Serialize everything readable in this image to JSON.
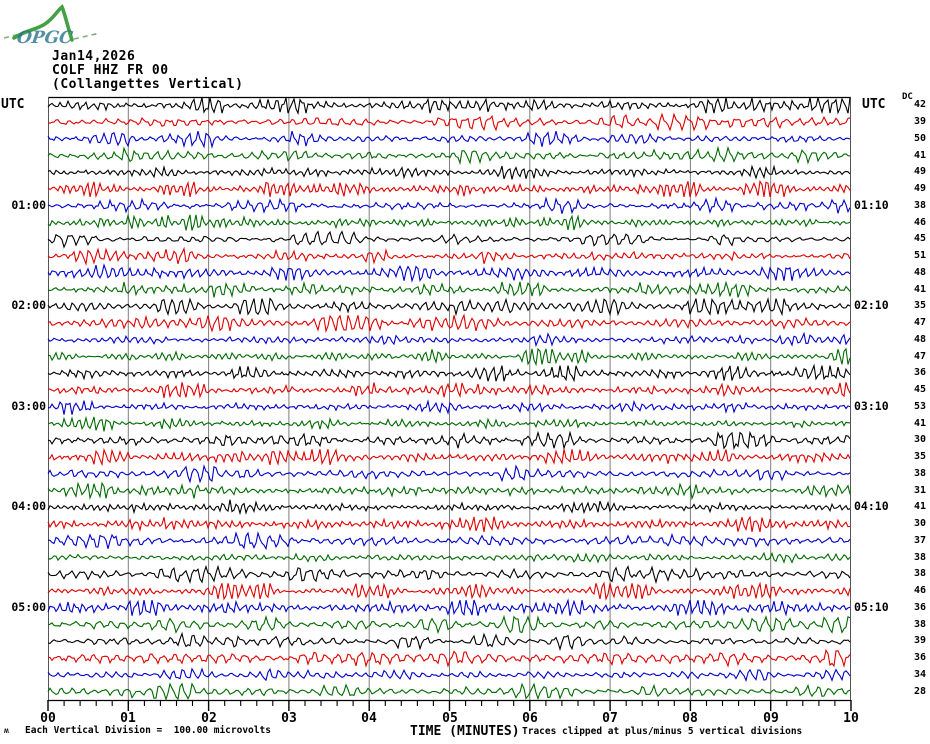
{
  "header": {
    "logo_text": "OPGC",
    "date": "Jan14,2026",
    "station": "COLF HHZ FR 00",
    "station_name": "(Collangettes Vertical)"
  },
  "axis": {
    "utc_left": "UTC",
    "utc_right": "UTC",
    "dc_label": "DC",
    "x_title": "TIME (MINUTES)",
    "x_tick_labels": [
      "00",
      "01",
      "02",
      "03",
      "04",
      "05",
      "06",
      "07",
      "08",
      "09",
      "10"
    ]
  },
  "footer": {
    "corner_mark": "ʍ",
    "scale_note": "Each Vertical Division =  100.00 microvolts",
    "clip_note": "Traces clipped at plus/minus 5 vertical divisions"
  },
  "chart_data": {
    "type": "line",
    "subtype": "helicorder_seismogram",
    "date": "Jan14,2026",
    "station": "COLF HHZ FR 00",
    "station_description": "(Collangettes Vertical)",
    "xlabel": "TIME (MINUTES)",
    "x_range_minutes": [
      0,
      10
    ],
    "x_tick_labels": [
      "00",
      "01",
      "02",
      "03",
      "04",
      "05",
      "06",
      "07",
      "08",
      "09",
      "10"
    ],
    "minutes_per_row": 10,
    "num_rows": 36,
    "grid_on": true,
    "grid_color": "#7d7d7d",
    "trace_color_cycle": [
      "#000000",
      "#e00000",
      "#0000cc",
      "#006a00"
    ],
    "left_hour_labels": [
      {
        "row": 6,
        "label": "01:00"
      },
      {
        "row": 12,
        "label": "02:00"
      },
      {
        "row": 18,
        "label": "03:00"
      },
      {
        "row": 24,
        "label": "04:00"
      },
      {
        "row": 30,
        "label": "05:00"
      }
    ],
    "right_hour_labels": [
      {
        "row": 6,
        "label": "01:10"
      },
      {
        "row": 12,
        "label": "02:10"
      },
      {
        "row": 18,
        "label": "03:10"
      },
      {
        "row": 24,
        "label": "04:10"
      },
      {
        "row": 30,
        "label": "05:10"
      }
    ],
    "dc_values": [
      42,
      39,
      50,
      41,
      49,
      49,
      38,
      46,
      45,
      51,
      48,
      41,
      35,
      47,
      48,
      47,
      36,
      45,
      53,
      41,
      30,
      35,
      38,
      31,
      41,
      30,
      37,
      38,
      38,
      46,
      36,
      38,
      39,
      36,
      34,
      28
    ],
    "scale_note": "Each Vertical Division =  100.00 microvolts",
    "clip_note": "Traces clipped at plus/minus 5 vertical divisions"
  }
}
